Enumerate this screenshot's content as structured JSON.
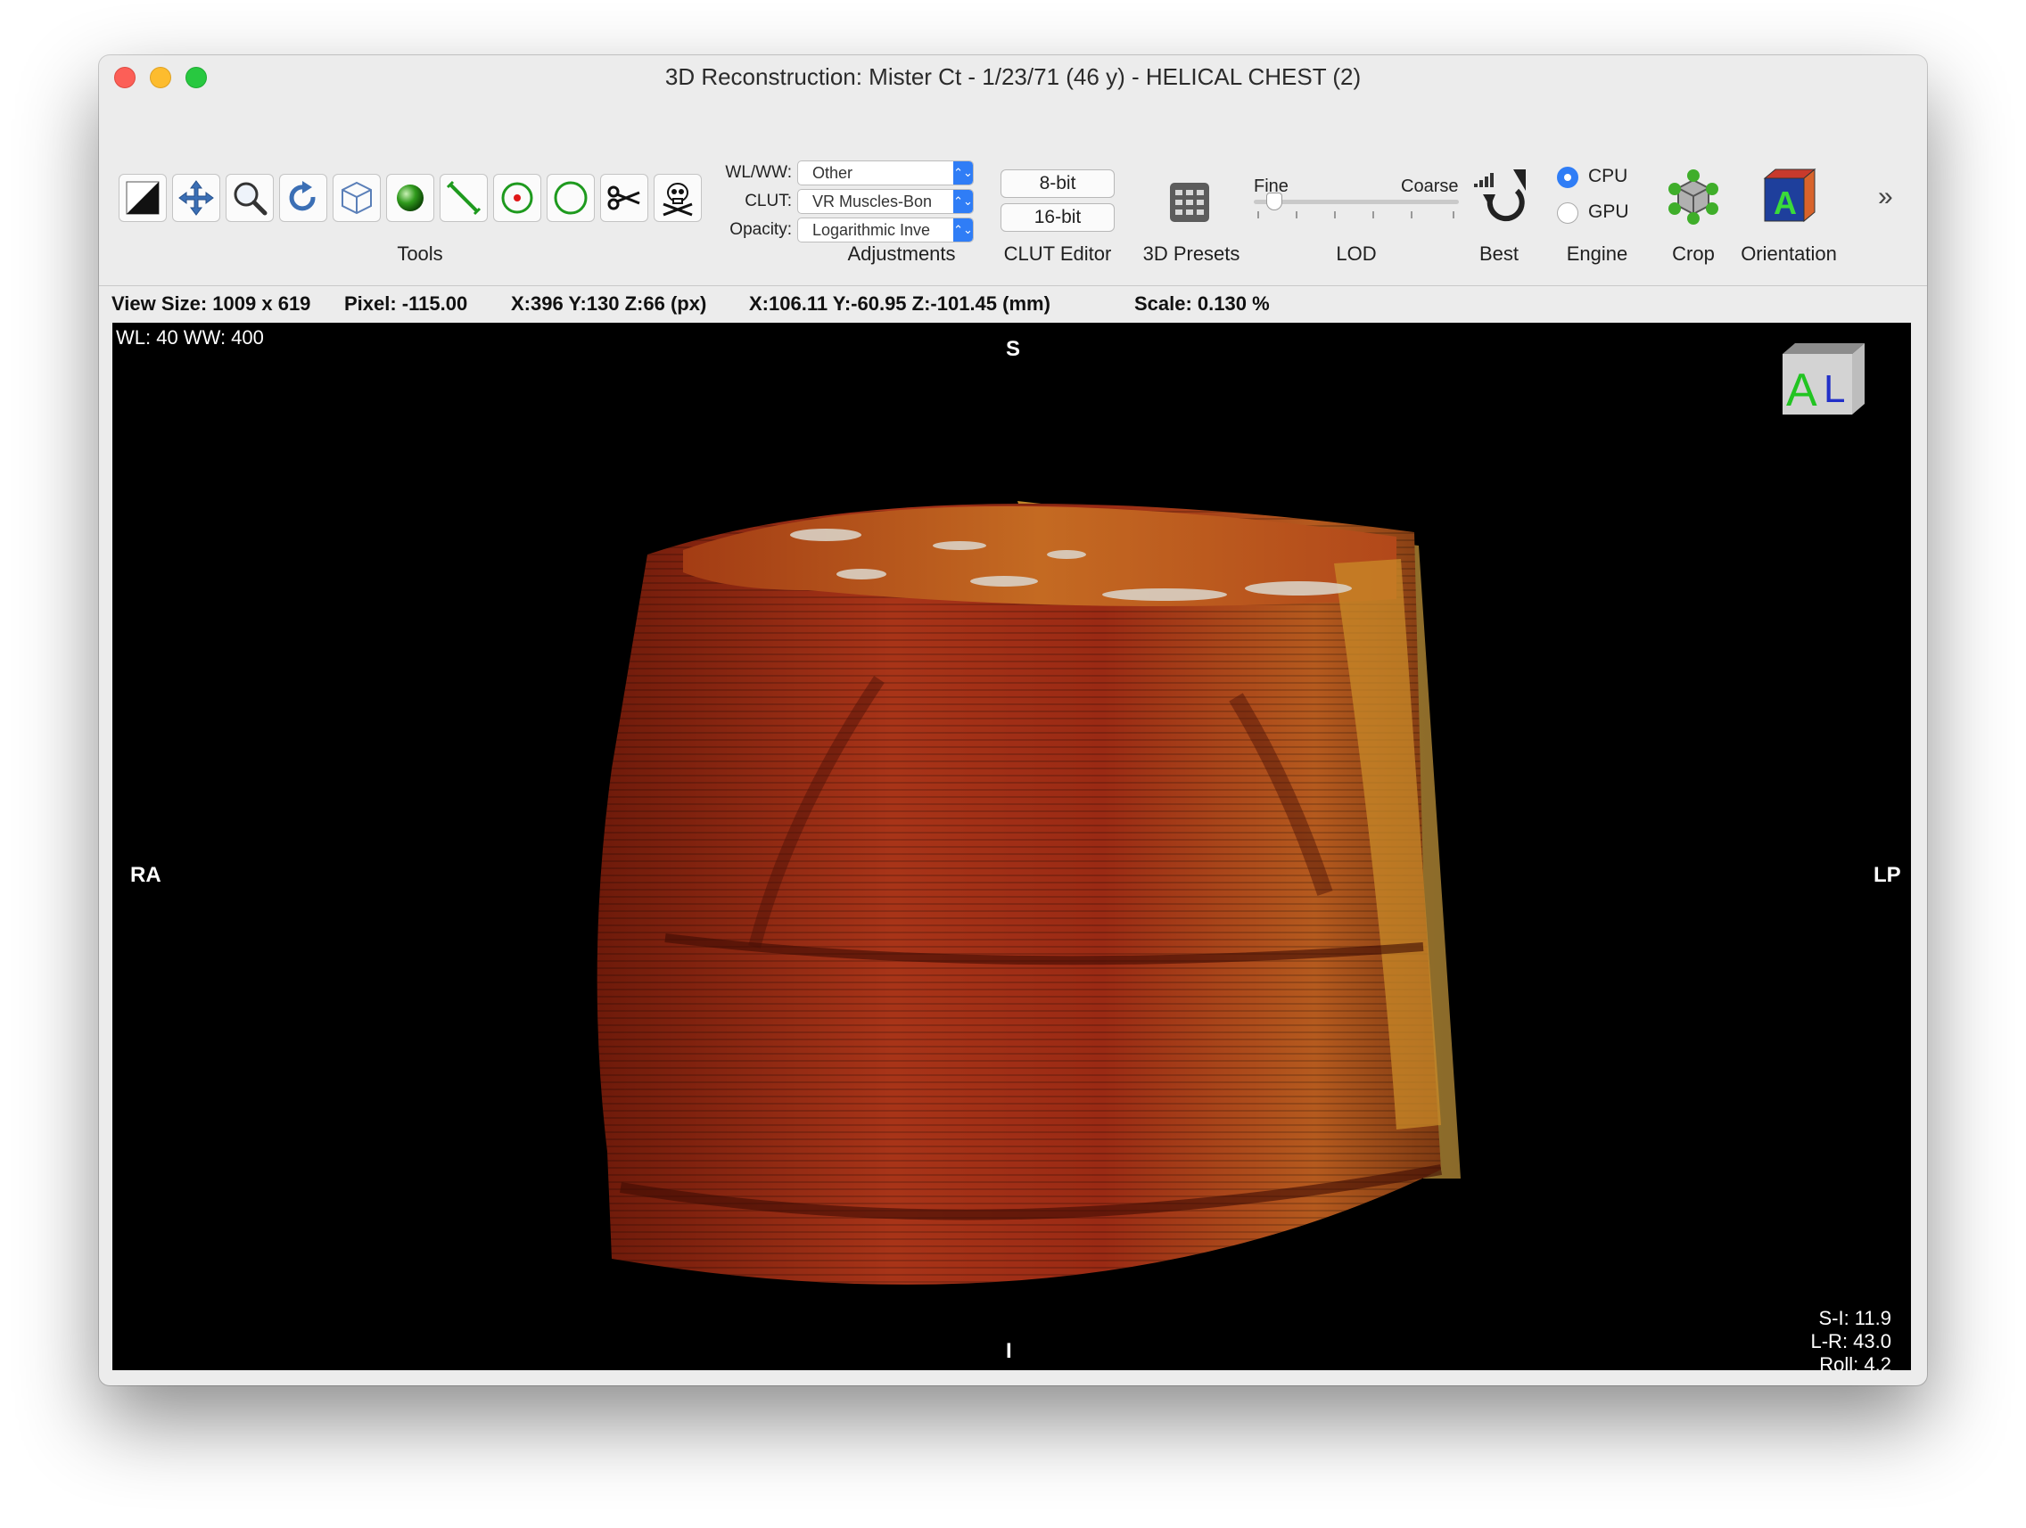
{
  "window": {
    "title": "3D Reconstruction: Mister Ct - 1/23/71 (46 y) - HELICAL CHEST (2)"
  },
  "toolbar": {
    "tools": [
      {
        "name": "window-level-tool-icon"
      },
      {
        "name": "move-tool-icon"
      },
      {
        "name": "zoom-tool-icon"
      },
      {
        "name": "rotate-tool-icon"
      },
      {
        "name": "3d-rotate-tool-icon"
      },
      {
        "name": "sphere-tool-icon"
      },
      {
        "name": "length-tool-icon"
      },
      {
        "name": "point-roi-tool-icon"
      },
      {
        "name": "oval-roi-tool-icon"
      },
      {
        "name": "scissors-tool-icon"
      },
      {
        "name": "bone-removal-tool-icon"
      }
    ],
    "tools_label": "Tools",
    "adjustments": {
      "wlww_label": "WL/WW:",
      "wlww_value": "Other",
      "clut_label": "CLUT:",
      "clut_value": "VR Muscles-Bon",
      "opacity_label": "Opacity:",
      "opacity_value": "Logarithmic Inve",
      "group_label": "Adjustments"
    },
    "clut_editor": {
      "btn_8bit": "8-bit",
      "btn_16bit": "16-bit",
      "group_label": "CLUT Editor"
    },
    "presets_label": "3D Presets",
    "lod": {
      "fine_label": "Fine",
      "coarse_label": "Coarse",
      "group_label": "LOD",
      "value": 0.1
    },
    "best_label": "Best",
    "engine": {
      "cpu_label": "CPU",
      "gpu_label": "GPU",
      "selected": "CPU",
      "group_label": "Engine"
    },
    "crop_label": "Crop",
    "orientation_label": "Orientation",
    "more_label": "»"
  },
  "status": {
    "view_size": "View Size: 1009 x 619",
    "pixel": "Pixel: -115.00",
    "px_coords": "X:396 Y:130 Z:66 (px)",
    "mm_coords": "X:106.11 Y:-60.95 Z:-101.45 (mm)",
    "scale": "Scale: 0.130 %"
  },
  "viewport": {
    "wlww": "WL: 40 WW: 400",
    "top": "S",
    "bottom": "I",
    "left": "RA",
    "right": "LP",
    "si": "S-I: 11.9",
    "lr": "L-R: 43.0",
    "roll": "Roll: 4.2",
    "cube_letters": [
      "A",
      "L"
    ]
  },
  "colors": {
    "accent": "#2f7df6",
    "volume_dark": "#5a1408",
    "volume_mid": "#a0301a",
    "volume_bright": "#c98a28"
  }
}
